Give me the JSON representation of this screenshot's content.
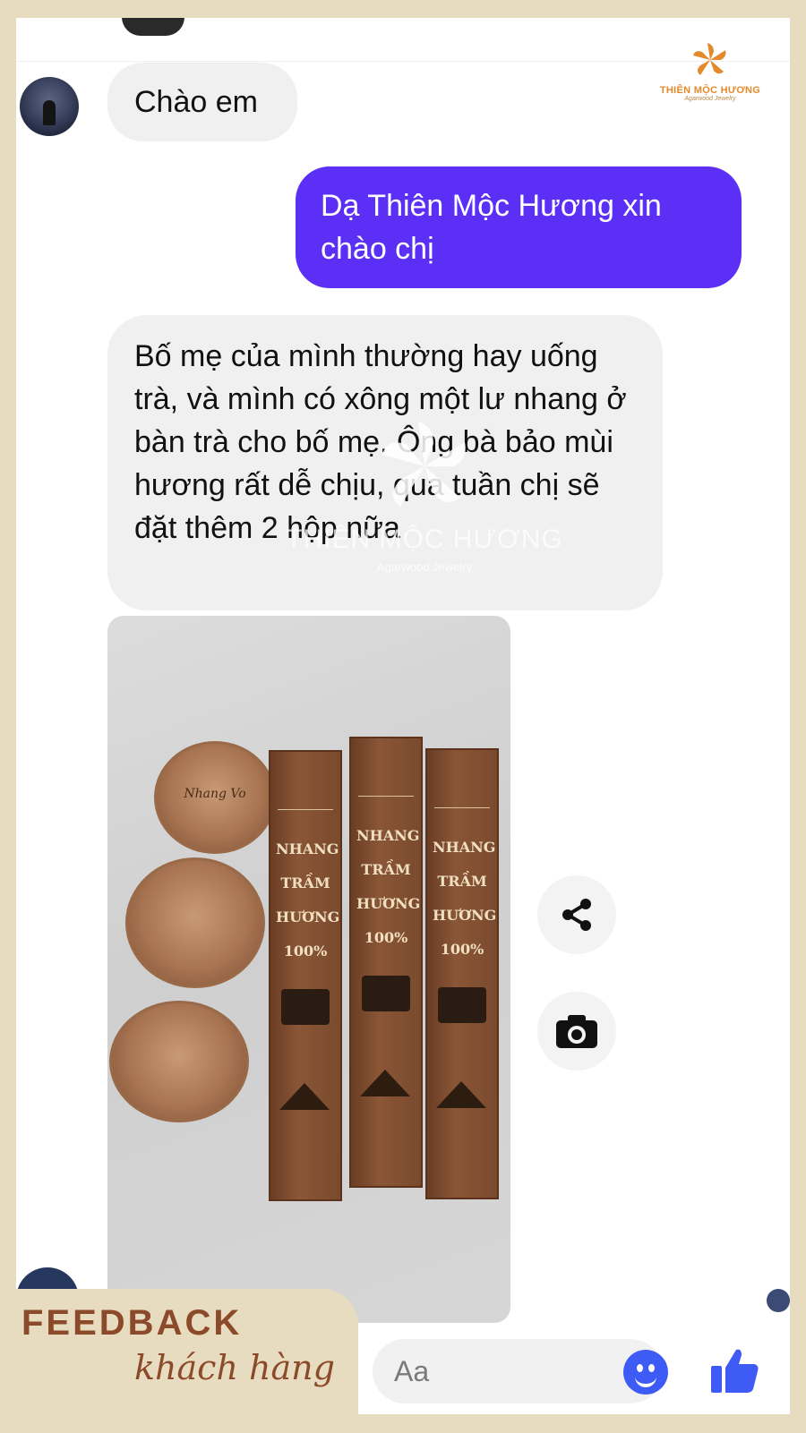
{
  "brand": {
    "logo_name": "THIÊN MỘC HƯƠNG",
    "logo_tagline": "Agarwood Jewelry",
    "accent_color": "#e48a2c"
  },
  "watermark": {
    "name": "THIÊN MỘC HƯƠNG",
    "tagline": "Agarwood Jewelry"
  },
  "chat": {
    "messages": [
      {
        "side": "incoming",
        "text": "Chào em"
      },
      {
        "side": "outgoing",
        "text": "Dạ Thiên Mộc Hương xin chào chị"
      },
      {
        "side": "incoming",
        "text": "Bố mẹ của mình thường hay uống trà, và mình có xông một lư nhang ở bàn trà cho bố mẹ. Ông bà bảo mùi hương rất dễ chịu, qua tuần chị sẽ đặt thêm 2 hộp nữa"
      }
    ],
    "photo": {
      "jar_text": "Nhang Vo",
      "box_label": "NHANG TRẦM HƯƠNG 100%"
    },
    "actions": {
      "share_icon": "share-icon",
      "camera_icon": "camera-icon"
    },
    "outgoing_color": "#5b2ff6"
  },
  "composer": {
    "placeholder": "Aa",
    "emoji_icon": "emoji-icon",
    "like_icon": "thumbs-up-icon"
  },
  "banner": {
    "title": "FEEDBACK",
    "subtitle": "khách hàng",
    "color": "#8b4a2a"
  }
}
